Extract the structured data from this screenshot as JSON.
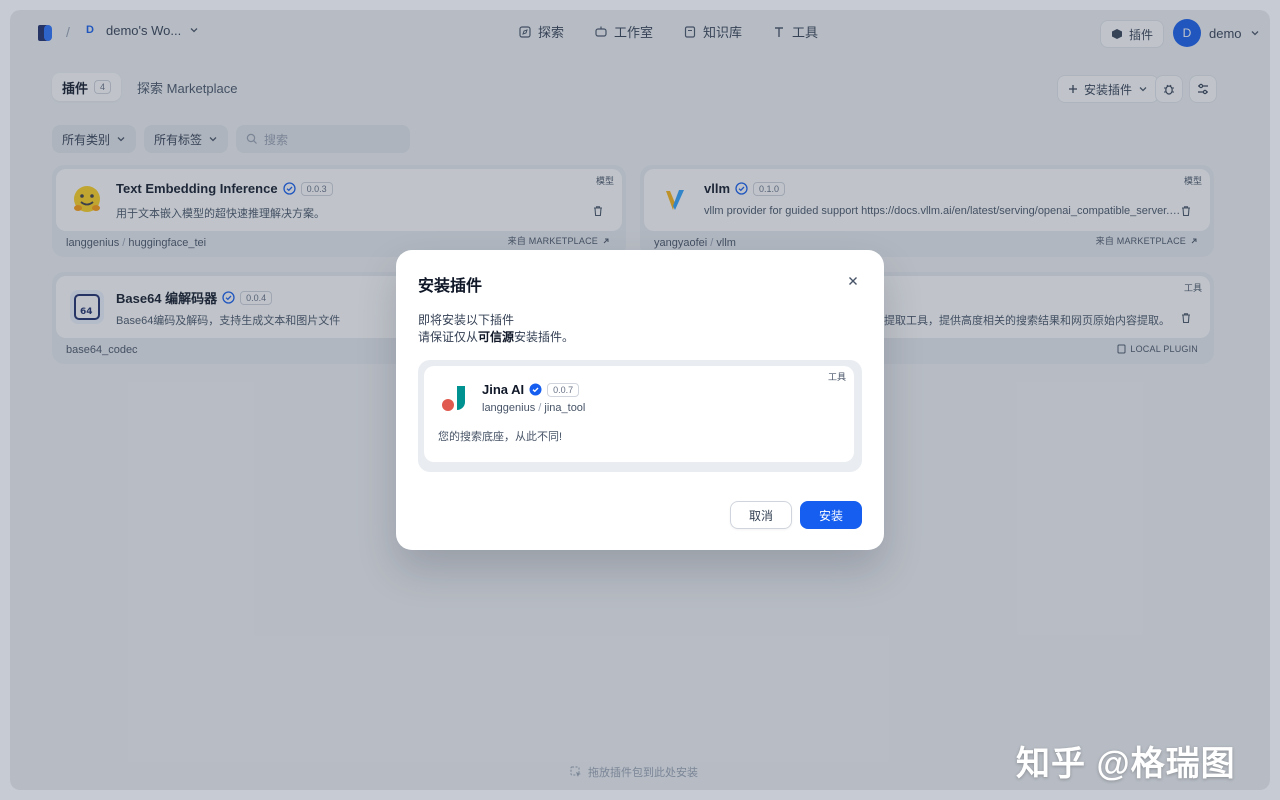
{
  "colors": {
    "accent": "#155eef",
    "verified": "#155eef"
  },
  "header": {
    "workspace_initial": "D",
    "workspace_name": "demo's Wo...",
    "nav": [
      {
        "label": "探索",
        "icon": "explore-icon"
      },
      {
        "label": "工作室",
        "icon": "studio-icon"
      },
      {
        "label": "知识库",
        "icon": "knowledge-icon"
      },
      {
        "label": "工具",
        "icon": "tools-icon"
      }
    ],
    "plugin_label": "插件",
    "user_initial": "D",
    "user_name": "demo"
  },
  "toolbar": {
    "tab_plugins": "插件",
    "tab_plugins_count": "4",
    "tab_marketplace": "探索 Marketplace",
    "install_label": "安装插件",
    "filter_category": "所有类别",
    "filter_tags": "所有标签",
    "search_placeholder": "搜索"
  },
  "cards": [
    {
      "title": "Text Embedding Inference",
      "version": "0.0.3",
      "desc": "用于文本嵌入模型的超快速推理解决方案。",
      "badge": "模型",
      "org": "langgenius",
      "name": "huggingface_tei",
      "source": "来自 MARKETPLACE"
    },
    {
      "title": "vllm",
      "version": "0.1.0",
      "desc": "vllm provider for guided support https://docs.vllm.ai/en/latest/serving/openai_compatible_server.html",
      "badge": "模型",
      "org": "yangyaofei",
      "name": "vllm",
      "source": "来自 MARKETPLACE"
    },
    {
      "title": "Base64 编解码器",
      "version": "0.0.4",
      "desc": "Base64编码及解码，支持生成文本和图片文件",
      "badge": "",
      "org": "base64_codec",
      "name": "",
      "source": ""
    },
    {
      "title": "",
      "version": "",
      "desc": "提取工具，提供高度相关的搜索结果和网页原始内容提取。",
      "badge": "工具",
      "org": "",
      "name": "",
      "source": "LOCAL PLUGIN"
    }
  ],
  "drop_hint": "拖放插件包到此处安装",
  "modal": {
    "title": "安装插件",
    "line1": "即将安装以下插件",
    "line2_pre": "请保证仅从",
    "line2_bold": "可信源",
    "line2_post": "安装插件。",
    "plugin": {
      "title": "Jina AI",
      "version": "0.0.7",
      "org": "langgenius",
      "name": "jina_tool",
      "desc": "您的搜索底座，从此不同!",
      "badge": "工具"
    },
    "cancel": "取消",
    "install": "安装"
  },
  "watermark": "知乎 @格瑞图"
}
